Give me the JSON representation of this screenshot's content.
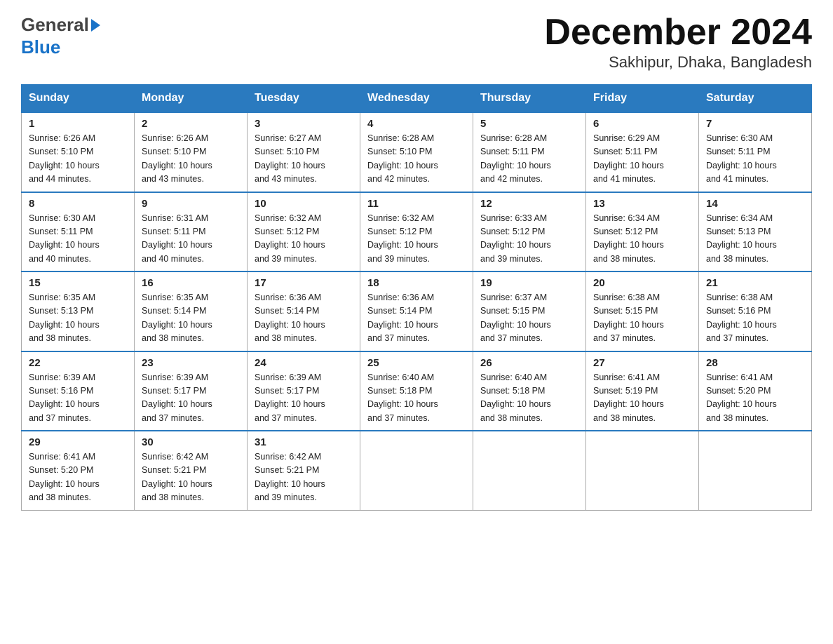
{
  "header": {
    "logo_general": "General",
    "logo_blue": "Blue",
    "month_title": "December 2024",
    "location": "Sakhipur, Dhaka, Bangladesh"
  },
  "days_of_week": [
    "Sunday",
    "Monday",
    "Tuesday",
    "Wednesday",
    "Thursday",
    "Friday",
    "Saturday"
  ],
  "weeks": [
    [
      {
        "day": "1",
        "sunrise": "6:26 AM",
        "sunset": "5:10 PM",
        "daylight": "10 hours and 44 minutes."
      },
      {
        "day": "2",
        "sunrise": "6:26 AM",
        "sunset": "5:10 PM",
        "daylight": "10 hours and 43 minutes."
      },
      {
        "day": "3",
        "sunrise": "6:27 AM",
        "sunset": "5:10 PM",
        "daylight": "10 hours and 43 minutes."
      },
      {
        "day": "4",
        "sunrise": "6:28 AM",
        "sunset": "5:10 PM",
        "daylight": "10 hours and 42 minutes."
      },
      {
        "day": "5",
        "sunrise": "6:28 AM",
        "sunset": "5:11 PM",
        "daylight": "10 hours and 42 minutes."
      },
      {
        "day": "6",
        "sunrise": "6:29 AM",
        "sunset": "5:11 PM",
        "daylight": "10 hours and 41 minutes."
      },
      {
        "day": "7",
        "sunrise": "6:30 AM",
        "sunset": "5:11 PM",
        "daylight": "10 hours and 41 minutes."
      }
    ],
    [
      {
        "day": "8",
        "sunrise": "6:30 AM",
        "sunset": "5:11 PM",
        "daylight": "10 hours and 40 minutes."
      },
      {
        "day": "9",
        "sunrise": "6:31 AM",
        "sunset": "5:11 PM",
        "daylight": "10 hours and 40 minutes."
      },
      {
        "day": "10",
        "sunrise": "6:32 AM",
        "sunset": "5:12 PM",
        "daylight": "10 hours and 39 minutes."
      },
      {
        "day": "11",
        "sunrise": "6:32 AM",
        "sunset": "5:12 PM",
        "daylight": "10 hours and 39 minutes."
      },
      {
        "day": "12",
        "sunrise": "6:33 AM",
        "sunset": "5:12 PM",
        "daylight": "10 hours and 39 minutes."
      },
      {
        "day": "13",
        "sunrise": "6:34 AM",
        "sunset": "5:12 PM",
        "daylight": "10 hours and 38 minutes."
      },
      {
        "day": "14",
        "sunrise": "6:34 AM",
        "sunset": "5:13 PM",
        "daylight": "10 hours and 38 minutes."
      }
    ],
    [
      {
        "day": "15",
        "sunrise": "6:35 AM",
        "sunset": "5:13 PM",
        "daylight": "10 hours and 38 minutes."
      },
      {
        "day": "16",
        "sunrise": "6:35 AM",
        "sunset": "5:14 PM",
        "daylight": "10 hours and 38 minutes."
      },
      {
        "day": "17",
        "sunrise": "6:36 AM",
        "sunset": "5:14 PM",
        "daylight": "10 hours and 38 minutes."
      },
      {
        "day": "18",
        "sunrise": "6:36 AM",
        "sunset": "5:14 PM",
        "daylight": "10 hours and 37 minutes."
      },
      {
        "day": "19",
        "sunrise": "6:37 AM",
        "sunset": "5:15 PM",
        "daylight": "10 hours and 37 minutes."
      },
      {
        "day": "20",
        "sunrise": "6:38 AM",
        "sunset": "5:15 PM",
        "daylight": "10 hours and 37 minutes."
      },
      {
        "day": "21",
        "sunrise": "6:38 AM",
        "sunset": "5:16 PM",
        "daylight": "10 hours and 37 minutes."
      }
    ],
    [
      {
        "day": "22",
        "sunrise": "6:39 AM",
        "sunset": "5:16 PM",
        "daylight": "10 hours and 37 minutes."
      },
      {
        "day": "23",
        "sunrise": "6:39 AM",
        "sunset": "5:17 PM",
        "daylight": "10 hours and 37 minutes."
      },
      {
        "day": "24",
        "sunrise": "6:39 AM",
        "sunset": "5:17 PM",
        "daylight": "10 hours and 37 minutes."
      },
      {
        "day": "25",
        "sunrise": "6:40 AM",
        "sunset": "5:18 PM",
        "daylight": "10 hours and 37 minutes."
      },
      {
        "day": "26",
        "sunrise": "6:40 AM",
        "sunset": "5:18 PM",
        "daylight": "10 hours and 38 minutes."
      },
      {
        "day": "27",
        "sunrise": "6:41 AM",
        "sunset": "5:19 PM",
        "daylight": "10 hours and 38 minutes."
      },
      {
        "day": "28",
        "sunrise": "6:41 AM",
        "sunset": "5:20 PM",
        "daylight": "10 hours and 38 minutes."
      }
    ],
    [
      {
        "day": "29",
        "sunrise": "6:41 AM",
        "sunset": "5:20 PM",
        "daylight": "10 hours and 38 minutes."
      },
      {
        "day": "30",
        "sunrise": "6:42 AM",
        "sunset": "5:21 PM",
        "daylight": "10 hours and 38 minutes."
      },
      {
        "day": "31",
        "sunrise": "6:42 AM",
        "sunset": "5:21 PM",
        "daylight": "10 hours and 39 minutes."
      },
      null,
      null,
      null,
      null
    ]
  ],
  "labels": {
    "sunrise": "Sunrise:",
    "sunset": "Sunset:",
    "daylight": "Daylight:"
  }
}
